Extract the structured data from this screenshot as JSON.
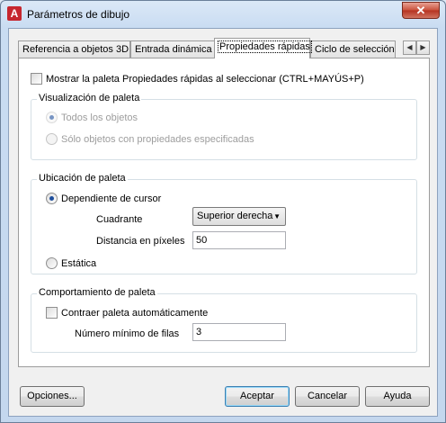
{
  "window": {
    "title": "Parámetros de dibujo",
    "close_label": "✕",
    "app_icon_letter": "A"
  },
  "tabs": [
    {
      "label": "Referencia a objetos 3D"
    },
    {
      "label": "Entrada dinámica"
    },
    {
      "label": "Propiedades rápidas"
    },
    {
      "label": "Ciclo de selección"
    }
  ],
  "tab_scroll": {
    "left": "◀",
    "right": "▶"
  },
  "panel": {
    "show_palette": {
      "label": "Mostrar la paleta Propiedades rápidas al seleccionar (CTRL+MAYÚS+P)",
      "checked": false
    },
    "display_group": {
      "title": "Visualización de paleta",
      "all_objects": "Todos los objetos",
      "specified_only": "Sólo objetos con propiedades especificadas"
    },
    "location_group": {
      "title": "Ubicación de paleta",
      "cursor_dependent": "Dependiente de cursor",
      "quadrant_label": "Cuadrante",
      "quadrant_value": "Superior derecha",
      "distance_label": "Distancia en píxeles",
      "distance_value": "50",
      "static": "Estática"
    },
    "behavior_group": {
      "title": "Comportamiento de paleta",
      "collapse_label": "Contraer paleta automáticamente",
      "min_rows_label": "Número mínimo de filas",
      "min_rows_value": "3"
    }
  },
  "buttons": {
    "options": "Opciones...",
    "accept": "Aceptar",
    "cancel": "Cancelar",
    "help": "Ayuda"
  }
}
